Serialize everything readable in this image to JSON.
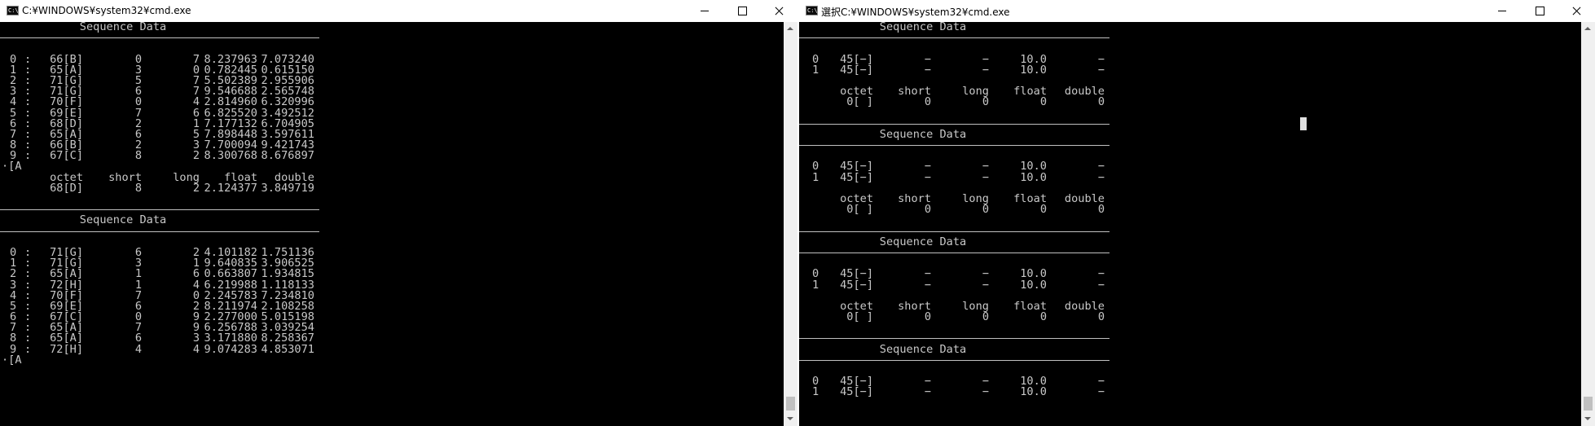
{
  "left": {
    "title": "C:¥WINDOWS¥system32¥cmd.exe",
    "icon_text": "C:\\",
    "lines": [
      {
        "t": "center",
        "text": "Sequence Data"
      },
      {
        "t": "sep"
      },
      {
        "t": "blank"
      },
      {
        "t": "row",
        "idx": "0",
        "colon": ":",
        "c1": "66[B]",
        "c2": "0",
        "c3": "7",
        "c4": "8.237963",
        "c5": "7.073240"
      },
      {
        "t": "row",
        "idx": "1",
        "colon": ":",
        "c1": "65[A]",
        "c2": "3",
        "c3": "0",
        "c4": "0.782445",
        "c5": "0.615150"
      },
      {
        "t": "row",
        "idx": "2",
        "colon": ":",
        "c1": "71[G]",
        "c2": "5",
        "c3": "7",
        "c4": "5.502389",
        "c5": "2.955906"
      },
      {
        "t": "row",
        "idx": "3",
        "colon": ":",
        "c1": "71[G]",
        "c2": "6",
        "c3": "7",
        "c4": "9.546688",
        "c5": "2.565748"
      },
      {
        "t": "row",
        "idx": "4",
        "colon": ":",
        "c1": "70[F]",
        "c2": "0",
        "c3": "4",
        "c4": "2.814960",
        "c5": "6.320996"
      },
      {
        "t": "row",
        "idx": "5",
        "colon": ":",
        "c1": "69[E]",
        "c2": "7",
        "c3": "6",
        "c4": "6.825520",
        "c5": "3.492512"
      },
      {
        "t": "row",
        "idx": "6",
        "colon": ":",
        "c1": "68[D]",
        "c2": "2",
        "c3": "1",
        "c4": "7.177132",
        "c5": "6.704905"
      },
      {
        "t": "row",
        "idx": "7",
        "colon": ":",
        "c1": "65[A]",
        "c2": "6",
        "c3": "5",
        "c4": "7.898448",
        "c5": "3.597611"
      },
      {
        "t": "row",
        "idx": "8",
        "colon": ":",
        "c1": "66[B]",
        "c2": "2",
        "c3": "3",
        "c4": "7.700094",
        "c5": "9.421743"
      },
      {
        "t": "row",
        "idx": "9",
        "colon": ":",
        "c1": "67[C]",
        "c2": "8",
        "c3": "2",
        "c4": "8.300768",
        "c5": "8.676897"
      },
      {
        "t": "prompt",
        "text": "·[A"
      },
      {
        "t": "header",
        "c1": "octet",
        "c2": "short",
        "c3": "long",
        "c4": "float",
        "c5": "double"
      },
      {
        "t": "row",
        "idx": "",
        "colon": "",
        "c1": "68[D]",
        "c2": "8",
        "c3": "2",
        "c4": "2.124377",
        "c5": "3.849719"
      },
      {
        "t": "blank"
      },
      {
        "t": "sep"
      },
      {
        "t": "center",
        "text": "Sequence Data"
      },
      {
        "t": "sep"
      },
      {
        "t": "blank"
      },
      {
        "t": "row",
        "idx": "0",
        "colon": ":",
        "c1": "71[G]",
        "c2": "6",
        "c3": "2",
        "c4": "4.101182",
        "c5": "1.751136"
      },
      {
        "t": "row",
        "idx": "1",
        "colon": ":",
        "c1": "71[G]",
        "c2": "3",
        "c3": "1",
        "c4": "9.640835",
        "c5": "3.906525"
      },
      {
        "t": "row",
        "idx": "2",
        "colon": ":",
        "c1": "65[A]",
        "c2": "1",
        "c3": "6",
        "c4": "0.663807",
        "c5": "1.934815"
      },
      {
        "t": "row",
        "idx": "3",
        "colon": ":",
        "c1": "72[H]",
        "c2": "1",
        "c3": "4",
        "c4": "6.219988",
        "c5": "1.118133"
      },
      {
        "t": "row",
        "idx": "4",
        "colon": ":",
        "c1": "70[F]",
        "c2": "7",
        "c3": "0",
        "c4": "2.245783",
        "c5": "7.234810"
      },
      {
        "t": "row",
        "idx": "5",
        "colon": ":",
        "c1": "69[E]",
        "c2": "6",
        "c3": "2",
        "c4": "8.211974",
        "c5": "2.108258"
      },
      {
        "t": "row",
        "idx": "6",
        "colon": ":",
        "c1": "67[C]",
        "c2": "0",
        "c3": "9",
        "c4": "2.277000",
        "c5": "5.015198"
      },
      {
        "t": "row",
        "idx": "7",
        "colon": ":",
        "c1": "65[A]",
        "c2": "7",
        "c3": "9",
        "c4": "6.256788",
        "c5": "3.039254"
      },
      {
        "t": "row",
        "idx": "8",
        "colon": ":",
        "c1": "65[A]",
        "c2": "6",
        "c3": "3",
        "c4": "3.171880",
        "c5": "8.258367"
      },
      {
        "t": "row",
        "idx": "9",
        "colon": ":",
        "c1": "72[H]",
        "c2": "4",
        "c3": "4",
        "c4": "9.074283",
        "c5": "4.853071"
      },
      {
        "t": "prompt",
        "text": "·[A"
      }
    ]
  },
  "right": {
    "title": "選択C:¥WINDOWS¥system32¥cmd.exe",
    "icon_text": "C:\\",
    "lines": [
      {
        "t": "center",
        "text": "Sequence Data"
      },
      {
        "t": "sep"
      },
      {
        "t": "blank"
      },
      {
        "t": "row",
        "idx": "0",
        "colon": "",
        "c1": "45[−]",
        "c2": "−",
        "c3": "−",
        "c4": "10.0",
        "c5": "−"
      },
      {
        "t": "row",
        "idx": "1",
        "colon": "",
        "c1": "45[−]",
        "c2": "−",
        "c3": "−",
        "c4": "10.0",
        "c5": "−"
      },
      {
        "t": "blank"
      },
      {
        "t": "header",
        "c1": "octet",
        "c2": "short",
        "c3": "long",
        "c4": "float",
        "c5": "double"
      },
      {
        "t": "row",
        "idx": "",
        "colon": "",
        "c1": "0[ ]",
        "c2": "0",
        "c3": "0",
        "c4": "0",
        "c5": "0"
      },
      {
        "t": "blank"
      },
      {
        "t": "sep"
      },
      {
        "t": "center",
        "text": "Sequence Data"
      },
      {
        "t": "sep"
      },
      {
        "t": "blank"
      },
      {
        "t": "row",
        "idx": "0",
        "colon": "",
        "c1": "45[−]",
        "c2": "−",
        "c3": "−",
        "c4": "10.0",
        "c5": "−"
      },
      {
        "t": "row",
        "idx": "1",
        "colon": "",
        "c1": "45[−]",
        "c2": "−",
        "c3": "−",
        "c4": "10.0",
        "c5": "−"
      },
      {
        "t": "blank"
      },
      {
        "t": "header",
        "c1": "octet",
        "c2": "short",
        "c3": "long",
        "c4": "float",
        "c5": "double"
      },
      {
        "t": "row",
        "idx": "",
        "colon": "",
        "c1": "0[ ]",
        "c2": "0",
        "c3": "0",
        "c4": "0",
        "c5": "0"
      },
      {
        "t": "blank"
      },
      {
        "t": "sep"
      },
      {
        "t": "center",
        "text": "Sequence Data"
      },
      {
        "t": "sep"
      },
      {
        "t": "blank"
      },
      {
        "t": "row",
        "idx": "0",
        "colon": "",
        "c1": "45[−]",
        "c2": "−",
        "c3": "−",
        "c4": "10.0",
        "c5": "−"
      },
      {
        "t": "row",
        "idx": "1",
        "colon": "",
        "c1": "45[−]",
        "c2": "−",
        "c3": "−",
        "c4": "10.0",
        "c5": "−"
      },
      {
        "t": "blank"
      },
      {
        "t": "header",
        "c1": "octet",
        "c2": "short",
        "c3": "long",
        "c4": "float",
        "c5": "double"
      },
      {
        "t": "row",
        "idx": "",
        "colon": "",
        "c1": "0[ ]",
        "c2": "0",
        "c3": "0",
        "c4": "0",
        "c5": "0"
      },
      {
        "t": "blank"
      },
      {
        "t": "sep"
      },
      {
        "t": "center",
        "text": "Sequence Data"
      },
      {
        "t": "sep"
      },
      {
        "t": "blank"
      },
      {
        "t": "row",
        "idx": "0",
        "colon": "",
        "c1": "45[−]",
        "c2": "−",
        "c3": "−",
        "c4": "10.0",
        "c5": "−"
      },
      {
        "t": "row",
        "idx": "1",
        "colon": "",
        "c1": "45[−]",
        "c2": "−",
        "c3": "−",
        "c4": "10.0",
        "c5": "−"
      }
    ]
  }
}
